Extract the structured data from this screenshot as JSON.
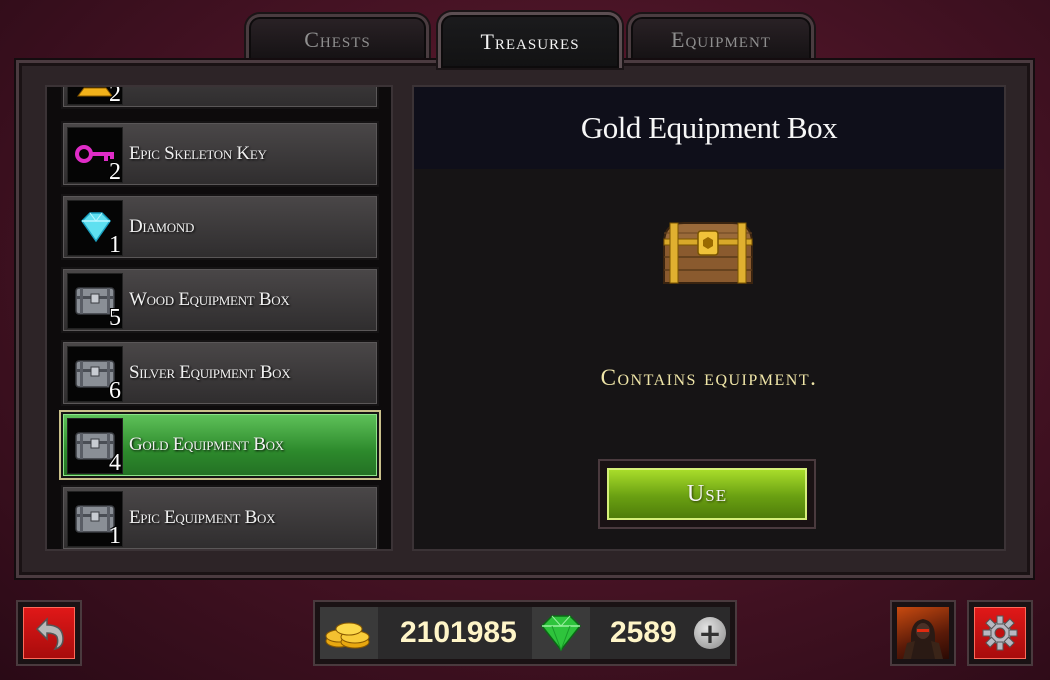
{
  "tabs": [
    {
      "label": "Chests",
      "active": false
    },
    {
      "label": "Treasures",
      "active": true
    },
    {
      "label": "Equipment",
      "active": false
    }
  ],
  "items": [
    {
      "label": "",
      "qty": "2",
      "icon": "gold-bar-icon"
    },
    {
      "label": "Epic Skeleton Key",
      "qty": "2",
      "icon": "key-icon"
    },
    {
      "label": "Diamond",
      "qty": "1",
      "icon": "diamond-icon"
    },
    {
      "label": "Wood Equipment Box",
      "qty": "5",
      "icon": "chest-icon"
    },
    {
      "label": "Silver Equipment Box",
      "qty": "6",
      "icon": "chest-icon"
    },
    {
      "label": "Gold Equipment Box",
      "qty": "4",
      "icon": "chest-icon",
      "selected": true
    },
    {
      "label": "Epic Equipment Box",
      "qty": "1",
      "icon": "chest-icon"
    }
  ],
  "detail": {
    "title": "Gold Equipment Box",
    "description": "Contains equipment.",
    "use_label": "Use",
    "icon": "gold-chest-icon"
  },
  "currency": {
    "gold": "2101985",
    "gems": "2589",
    "gold_icon": "gold-coins-icon",
    "gem_icon": "emerald-icon",
    "add_icon": "plus-icon"
  },
  "buttons": {
    "back_icon": "back-arrow-icon",
    "avatar": "hero-avatar",
    "settings_icon": "gear-icon"
  },
  "colors": {
    "selected_item": "#2d8a2c",
    "use_button": "#7ab81a",
    "red_button": "#c81010",
    "highlight_text": "#f0e6a8"
  }
}
